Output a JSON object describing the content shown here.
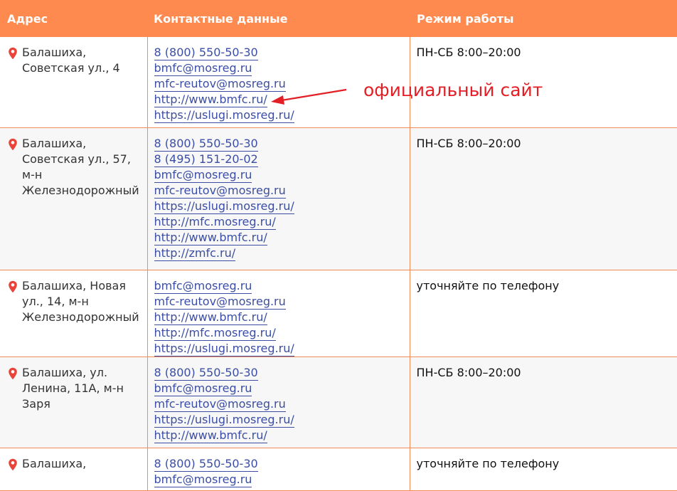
{
  "table": {
    "headers": {
      "address": "Адрес",
      "contacts": "Контактные данные",
      "hours": "Режим работы"
    },
    "rows": [
      {
        "address": "Балашиха, Советская ул., 4",
        "contacts": [
          "8 (800) 550-50-30",
          "bmfc@mosreg.ru",
          "mfc-reutov@mosreg.ru",
          "http://www.bmfc.ru/",
          "https://uslugi.mosreg.ru/"
        ],
        "hours": "ПН-СБ 8:00–20:00"
      },
      {
        "address": "Балашиха, Советская ул., 57, м-н Железнодорожный",
        "contacts": [
          "8 (800) 550-50-30",
          "8 (495) 151-20-02",
          "bmfc@mosreg.ru",
          "mfc-reutov@mosreg.ru",
          "https://uslugi.mosreg.ru/",
          "http://mfc.mosreg.ru/",
          "http://www.bmfc.ru/",
          "http://zmfc.ru/"
        ],
        "hours": "ПН-СБ 8:00–20:00"
      },
      {
        "address": "Балашиха, Новая ул., 14, м-н Железнодорожный",
        "contacts": [
          "bmfc@mosreg.ru",
          "mfc-reutov@mosreg.ru",
          "http://www.bmfc.ru/",
          "http://mfc.mosreg.ru/",
          "https://uslugi.mosreg.ru/"
        ],
        "hours": "уточняйте по телефону"
      },
      {
        "address": "Балашиха, ул. Ленина, 11А, м-н Заря",
        "contacts": [
          "8 (800) 550-50-30",
          "bmfc@mosreg.ru",
          "mfc-reutov@mosreg.ru",
          "https://uslugi.mosreg.ru/",
          "http://www.bmfc.ru/"
        ],
        "hours": "ПН-СБ 8:00–20:00"
      },
      {
        "address": "Балашиха,",
        "contacts": [
          "8 (800) 550-50-30",
          "bmfc@mosreg.ru"
        ],
        "hours": "уточняйте по телефону"
      }
    ]
  },
  "annotation": {
    "text": "официальный сайт"
  },
  "colors": {
    "header_bg": "#ff8a50",
    "border": "#f48a57",
    "link": "#3c4ea3",
    "pin": "#e8443a",
    "annotation": "#e31e24"
  },
  "icons": {
    "address_marker": "map-pin-icon"
  }
}
